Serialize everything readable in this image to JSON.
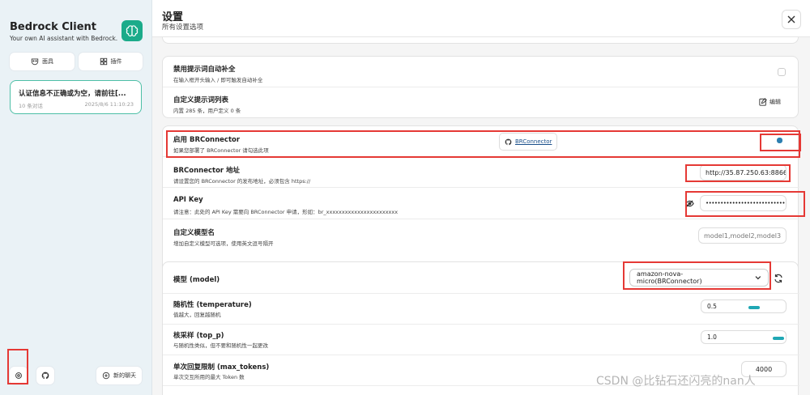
{
  "app": {
    "title": "Bedrock Client",
    "subtitle": "Your own AI assistant with Bedrock."
  },
  "sidebar": {
    "mask_button": "面具",
    "plugin_button": "插件",
    "chat": {
      "title": "认证信息不正确或为空，请前往[...",
      "count": "10 条对话",
      "time": "2025/8/6 11:10:23"
    },
    "new_chat_button": "新的聊天"
  },
  "header": {
    "title": "设置",
    "subtitle": "所有设置选项"
  },
  "settings": {
    "disable_autocomplete": {
      "title": "禁用提示词自动补全",
      "desc": "在输入框开头输入 / 即可触发自动补全",
      "checked": false
    },
    "custom_prompts": {
      "title": "自定义提示词列表",
      "desc": "内置 285 条，用户定义 0 条",
      "edit_label": "编辑"
    },
    "brconnector_enable": {
      "title": "启用 BRConnector",
      "desc": "如果您部署了 BRConnector 请勾选此项",
      "link_label": "BRConnector",
      "checked": true
    },
    "brconnector_url": {
      "title": "BRConnector 地址",
      "desc": "请设置您的 BRConnector 的发布地址，必须包含 https://",
      "value": "http://35.87.250.63:8866"
    },
    "api_key": {
      "title": "API Key",
      "desc": "请注意：此处的 API Key 需要向 BRConnector 申请，形如：br_xxxxxxxxxxxxxxxxxxxxxxx",
      "value": "•••••••••••••••••••••••••••••"
    },
    "custom_models": {
      "title": "自定义模型名",
      "desc": "增加自定义模型可选项，使用英文逗号隔开",
      "placeholder": "model1,model2,model3"
    },
    "model": {
      "title": "模型 (model)",
      "selected": "amazon-nova-micro(BRConnector)"
    },
    "temperature": {
      "title": "随机性 (temperature)",
      "desc": "值越大，回复越随机",
      "value": "0.5",
      "fraction": 0.5
    },
    "top_p": {
      "title": "核采样 (top_p)",
      "desc": "与随机性类似，但不要和随机性一起更改",
      "value": "1.0",
      "fraction": 1.0
    },
    "max_tokens": {
      "title": "单次回复限制 (max_tokens)",
      "desc": "单次交互所用的最大 Token 数",
      "value": "4000"
    }
  },
  "watermark": "CSDN @比钻石还闪亮的nan人",
  "colors": {
    "accent": "#1bab8a",
    "highlight": "#e53935",
    "slider": "#1fa7b4"
  }
}
